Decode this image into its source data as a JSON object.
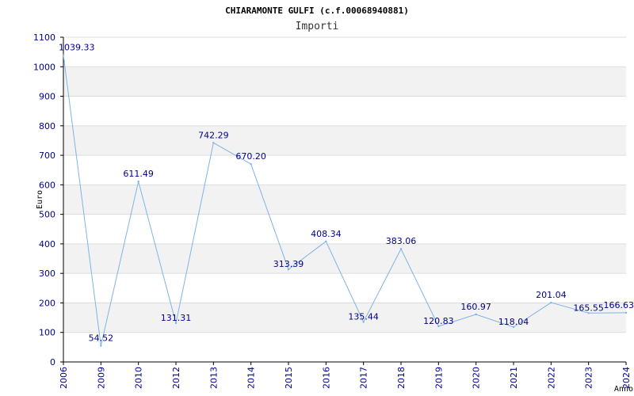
{
  "chart_data": {
    "type": "line",
    "title": "CHIARAMONTE GULFI (c.f.00068940881)",
    "subtitle": "Importi",
    "xlabel": "Anno",
    "ylabel": "Euro",
    "ylim": [
      0,
      1100
    ],
    "yticks": [
      0,
      100,
      200,
      300,
      400,
      500,
      600,
      700,
      800,
      900,
      1000,
      1100
    ],
    "grid": "horizontal-bands",
    "categories": [
      "2006",
      "2009",
      "2010",
      "2012",
      "2013",
      "2014",
      "2015",
      "2016",
      "2017",
      "2018",
      "2019",
      "2020",
      "2021",
      "2022",
      "2023",
      "2024"
    ],
    "values": [
      1039.33,
      54.52,
      611.49,
      131.31,
      742.29,
      670.2,
      313.39,
      408.34,
      135.44,
      383.06,
      120.83,
      160.97,
      118.04,
      201.04,
      165.55,
      166.63
    ],
    "value_labels": [
      "1039.33",
      "54.52",
      "611.49",
      "131.31",
      "742.29",
      "670.20",
      "313.39",
      "408.34",
      "135.44",
      "383.06",
      "120.83",
      "160.97",
      "118.04",
      "201.04",
      "165.55",
      "166.63"
    ],
    "colors": {
      "line": "#7fb3e6",
      "band": "#f2f2f2",
      "gridline": "#dddddd",
      "axis": "#000000",
      "label": "#00008b"
    }
  }
}
